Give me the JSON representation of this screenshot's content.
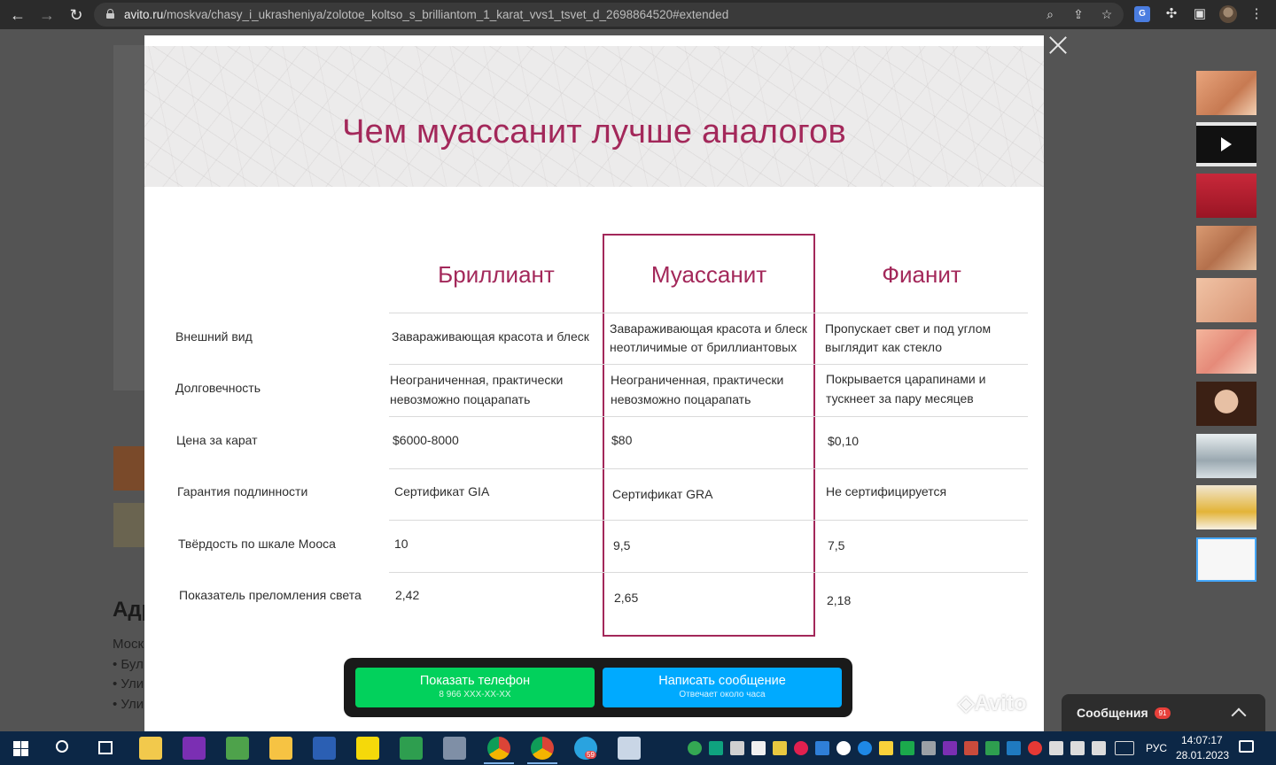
{
  "browser": {
    "url_host": "avito.ru",
    "url_path": "/moskva/chasy_i_ukrasheniya/zolotoe_koltso_s_brilliantom_1_karat_vvs1_tsvet_d_2698864520#extended"
  },
  "slide": {
    "title": "Чем муассанит лучше аналогов",
    "columns": [
      "Бриллиант",
      "Муассанит",
      "Фианит"
    ],
    "rows": [
      {
        "label": "Внешний вид",
        "cells": [
          "Завараживающая красота и блеск",
          "Завараживающая красота и блеск неотличимые от бриллиантовых",
          "Пропускает свет и под углом выглядит как стекло"
        ]
      },
      {
        "label": "Долговечность",
        "cells": [
          "Неограниченная, практически невозможно поцарапать",
          "Неограниченная, практически невозможно поцарапать",
          "Покрывается царапинами и тускнеет за пару месяцев"
        ]
      },
      {
        "label": "Цена за карат",
        "cells": [
          "$6000-8000",
          "$80",
          "$0,10"
        ]
      },
      {
        "label": "Гарантия подлинности",
        "cells": [
          "Сертификат GIA",
          "Сертификат GRA",
          "Не сертифицируется"
        ]
      },
      {
        "label": "Твёрдость по шкале Мооса",
        "cells": [
          "10",
          "9,5",
          "7,5"
        ]
      },
      {
        "label": "Показатель преломления света",
        "cells": [
          "2,42",
          "2,65",
          "2,18"
        ]
      }
    ],
    "highlight_color": "#a3285a",
    "watermark": "Avito"
  },
  "actions": {
    "phone_label": "Показать телефон",
    "phone_sub": "8 966 XXX-XX-XX",
    "phone_color": "#02d15c",
    "message_label": "Написать сообщение",
    "message_sub": "Отвечает около часа",
    "message_color": "#00aaff"
  },
  "background_page": {
    "heading": "Адр",
    "lines": [
      "Моск",
      "• Бул",
      "• Ули",
      "• Ули"
    ]
  },
  "messages": {
    "title": "Сообщения",
    "badge": "91"
  },
  "taskbar": {
    "lang": "РУС",
    "time": "14:07:17",
    "date": "28.01.2023",
    "telegram_badge": "59"
  }
}
